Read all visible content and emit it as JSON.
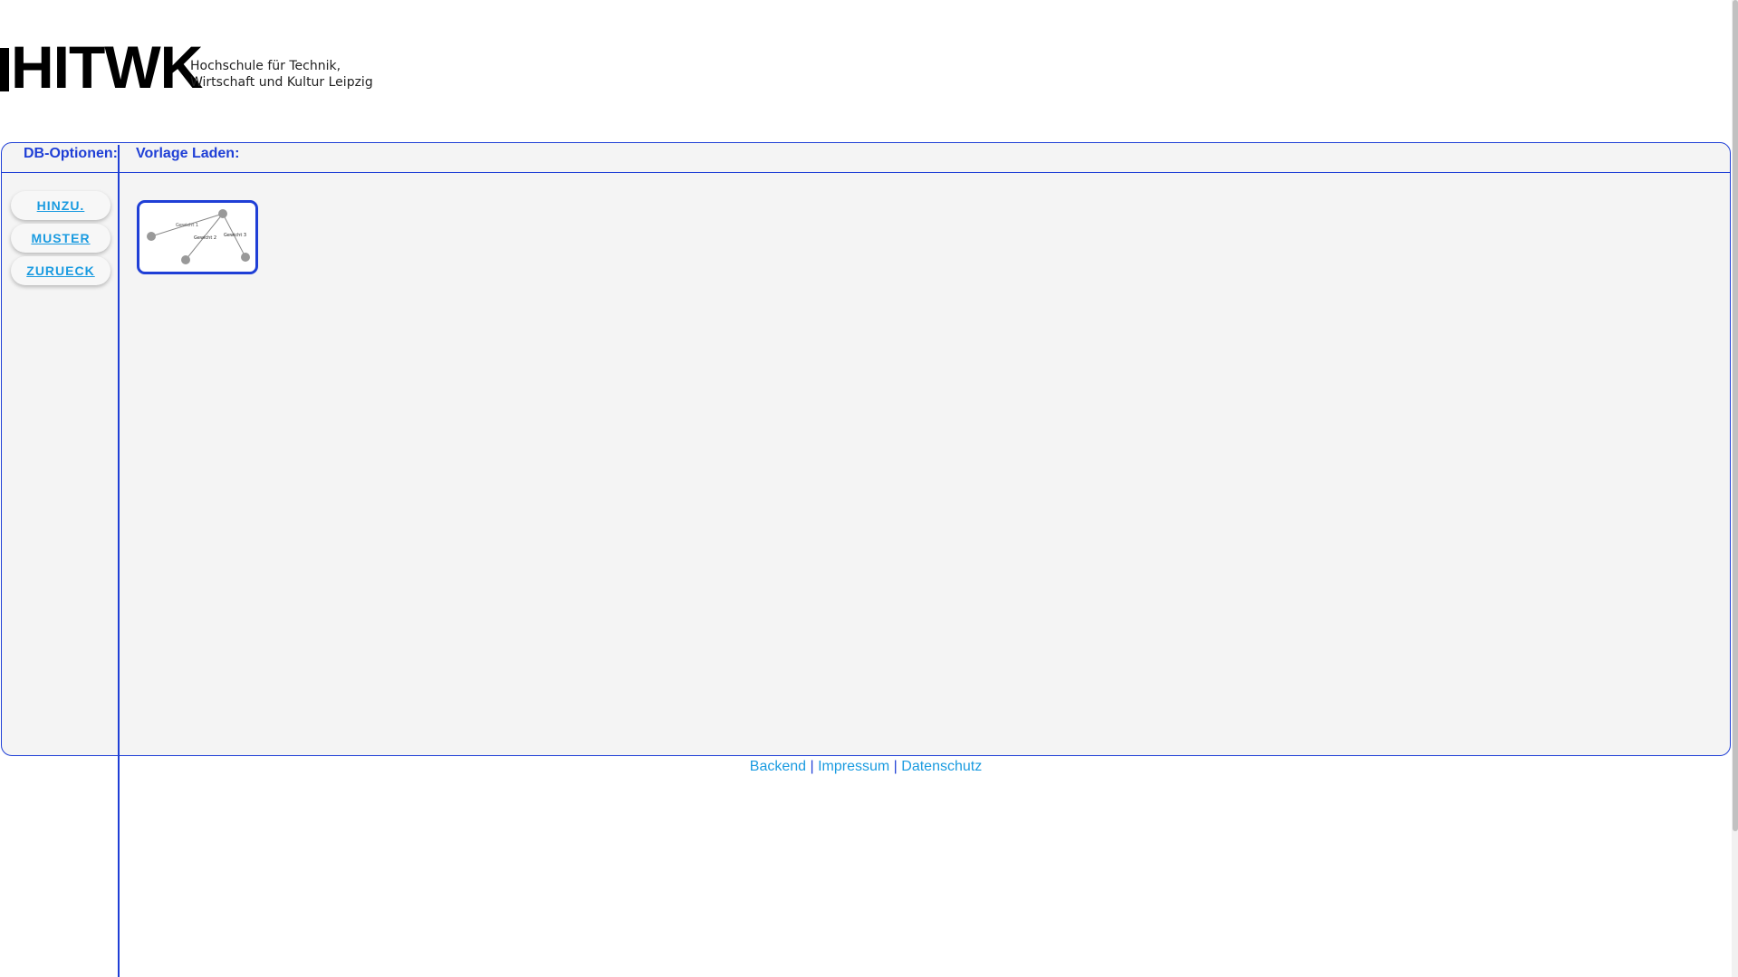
{
  "logo": {
    "mark": "HITWK",
    "subtitle_line1": "Hochschule für Technik,",
    "subtitle_line2": "Wirtschaft und Kultur Leipzig"
  },
  "header": {
    "left_label": "DB-Optionen:",
    "right_label": "Vorlage Laden:"
  },
  "sidebar": {
    "buttons": [
      {
        "label": "HINZU."
      },
      {
        "label": "MUSTER"
      },
      {
        "label": "ZURUECK"
      }
    ]
  },
  "templates": [
    {
      "edge_labels": [
        "Gewicht 1",
        "Gewicht 2",
        "Gewicht 3"
      ]
    }
  ],
  "footer": {
    "links": [
      "Backend",
      "Impressum",
      "Datenschutz"
    ],
    "separator": "|"
  },
  "colors": {
    "accent": "#1f3fd6",
    "link": "#1a9be0",
    "panel_bg": "#f4f4f4"
  }
}
